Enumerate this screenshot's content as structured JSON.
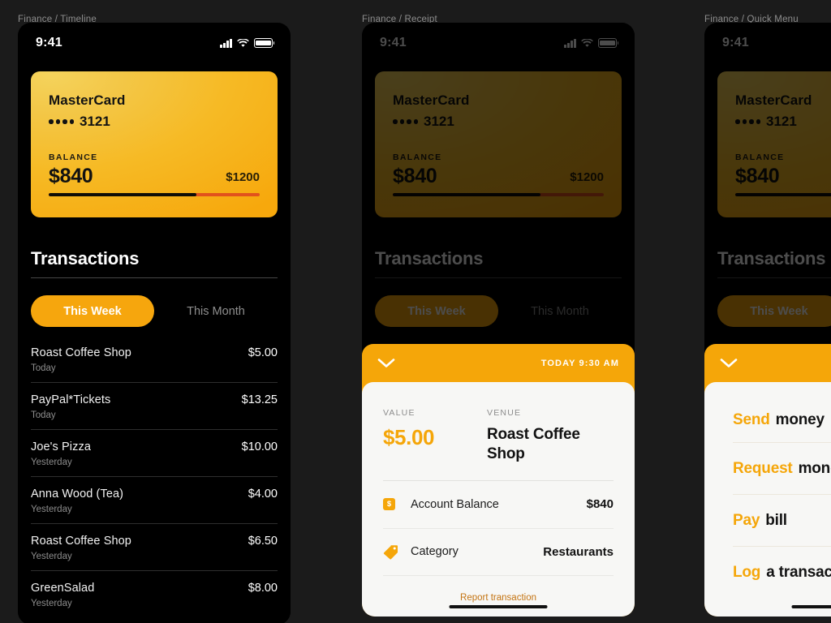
{
  "background_color": "#1b1b1b",
  "accent_color": "#f5a609",
  "frames": [
    {
      "label": "Finance / Timeline"
    },
    {
      "label": "Finance / Receipt"
    },
    {
      "label": "Finance / Quick Menu"
    }
  ],
  "status_bar": {
    "time": "9:41",
    "icons": [
      "signal-bars-icon",
      "wifi-icon",
      "battery-icon"
    ]
  },
  "card": {
    "brand": "MasterCard",
    "masked_dots": "••••",
    "last4": "3121",
    "balance_label": "BALANCE",
    "balance": "$840",
    "limit": "$1200",
    "progress_percent": 70
  },
  "transactions_section": {
    "title": "Transactions",
    "tabs": [
      {
        "label": "This Week",
        "active": true
      },
      {
        "label": "This Month",
        "active": false
      }
    ],
    "rows": [
      {
        "name": "Roast Coffee Shop",
        "when": "Today",
        "amount": "$5.00"
      },
      {
        "name": "PayPal*Tickets",
        "when": "Today",
        "amount": "$13.25"
      },
      {
        "name": "Joe's Pizza",
        "when": "Yesterday",
        "amount": "$10.00"
      },
      {
        "name": "Anna Wood (Tea)",
        "when": "Yesterday",
        "amount": "$4.00"
      },
      {
        "name": "Roast Coffee Shop",
        "when": "Yesterday",
        "amount": "$6.50"
      },
      {
        "name": "GreenSalad",
        "when": "Yesterday",
        "amount": "$8.00"
      }
    ]
  },
  "receipt_sheet": {
    "collapse_icon": "chevron-down-icon",
    "timestamp": "TODAY 9:30 AM",
    "value_label": "VALUE",
    "value": "$5.00",
    "venue_label": "VENUE",
    "venue": "Roast Coffee Shop",
    "rows": [
      {
        "icon": "dollar-badge-icon",
        "label": "Account Balance",
        "value": "$840"
      },
      {
        "icon": "tag-icon",
        "label": "Category",
        "value": "Restaurants"
      }
    ],
    "report_link": "Report transaction"
  },
  "quick_menu": {
    "collapse_icon": "chevron-down-icon",
    "items": [
      {
        "accent": "Send",
        "rest": "money"
      },
      {
        "accent": "Request",
        "rest": "money"
      },
      {
        "accent": "Pay",
        "rest": "bill"
      },
      {
        "accent": "Log",
        "rest": "a transaction"
      }
    ]
  }
}
